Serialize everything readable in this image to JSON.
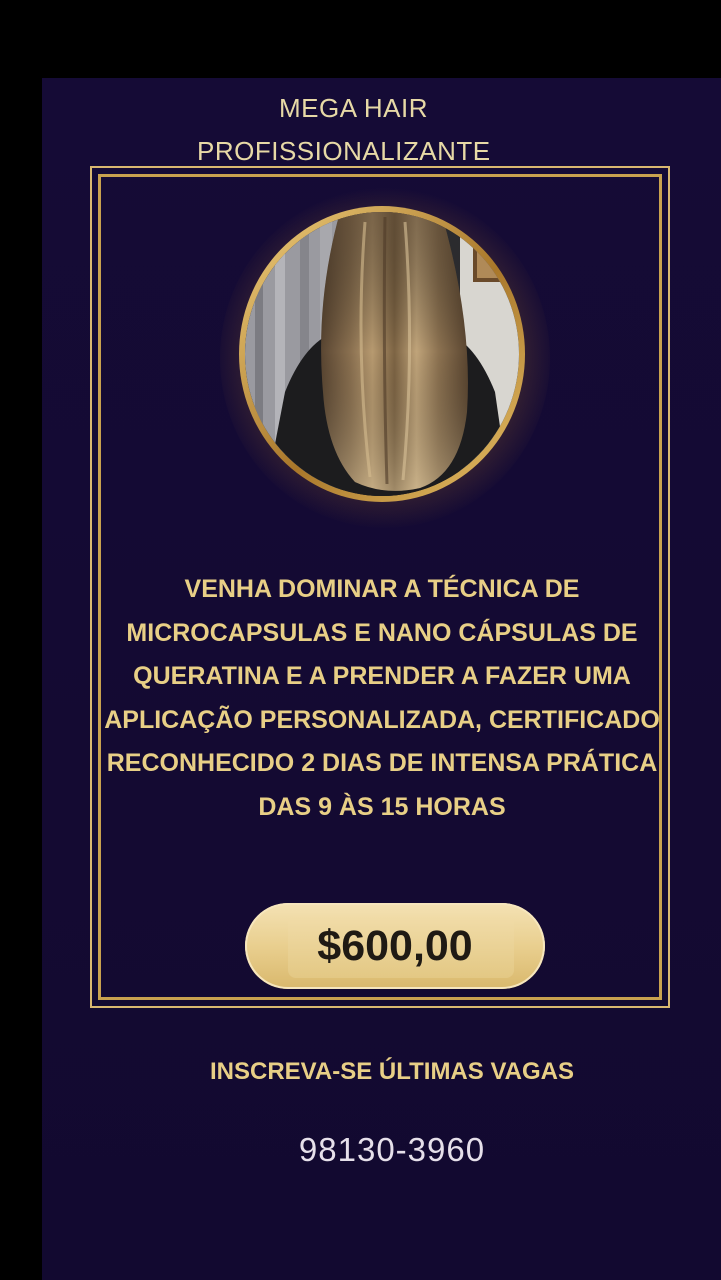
{
  "flyer": {
    "title_line1": "MEGA HAIR",
    "title_line2": "PROFISSIONALIZANTE",
    "image_alt": "Cabelo longo liso com mechas loiras",
    "description": "VENHA DOMINAR A TÉCNICA DE MICROCAPSULAS E NANO CÁPSULAS DE QUERATINA E A PRENDER A FAZER UMA APLICAÇÃO PERSONALIZADA, CERTIFICADO RECONHECIDO 2 DIAS DE INTENSA PRÁTICA DAS 9 ÀS 15 HORAS",
    "price": "$600,00",
    "cta": "INSCREVA-SE ÚLTIMAS VAGAS",
    "phone": "98130-3960"
  },
  "colors": {
    "background": "#140a33",
    "gold": "#e8cf86",
    "frame": "#c9a24f"
  }
}
